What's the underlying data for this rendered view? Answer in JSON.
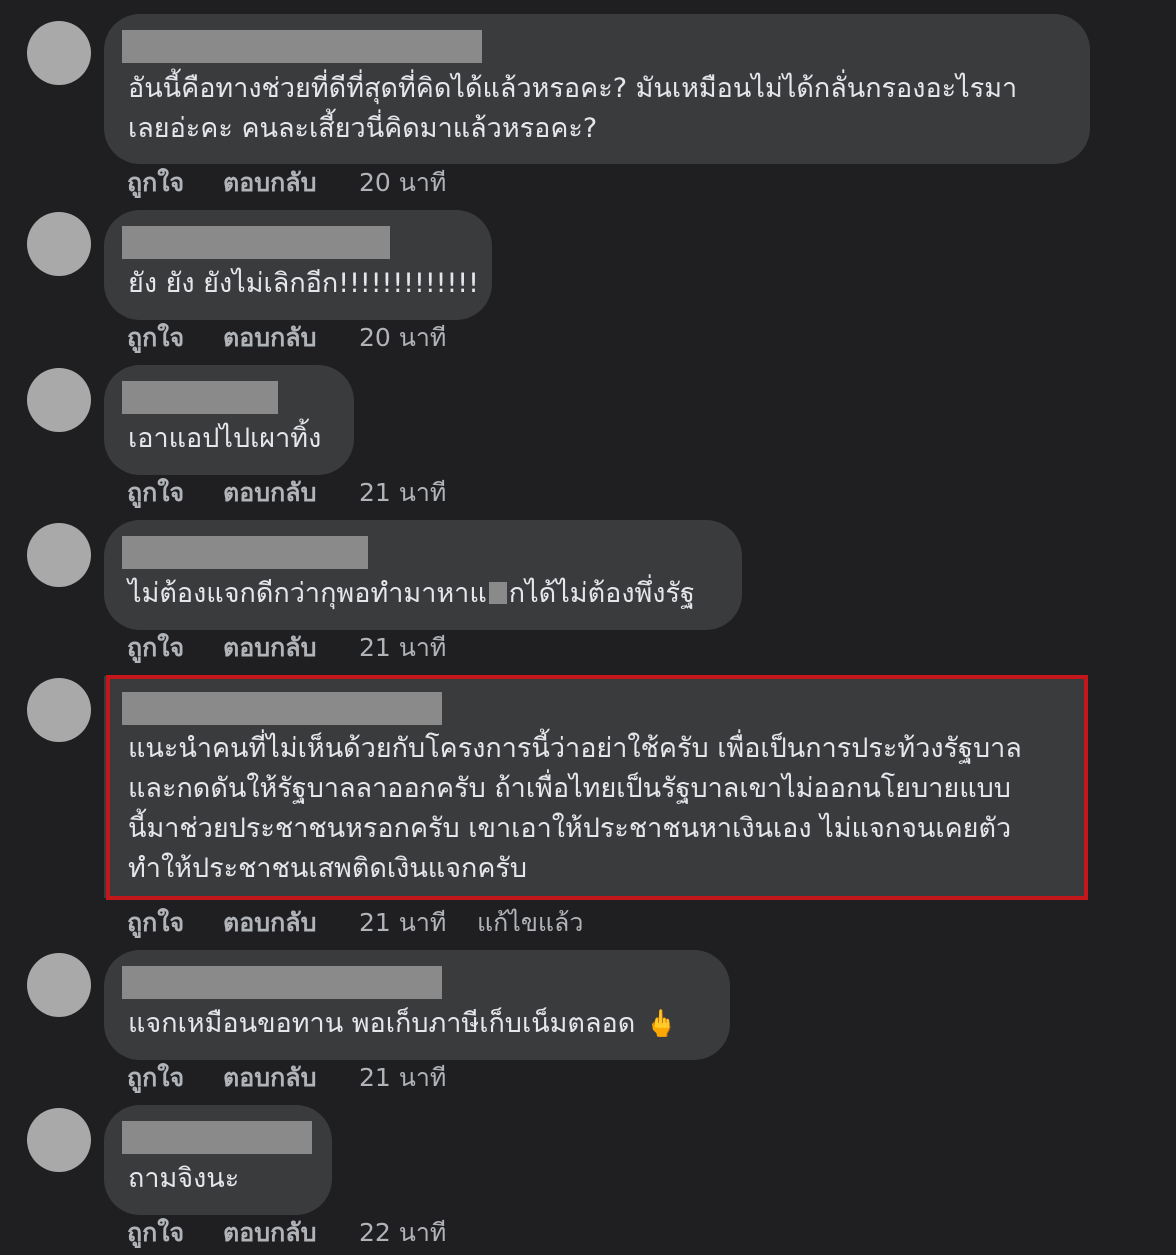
{
  "actions": {
    "like": "ถูกใจ",
    "reply": "ตอบกลับ",
    "edited": "แก้ไขแล้ว"
  },
  "comments": [
    {
      "lines": [
        "อันนี้คือทางช่วยที่ดีที่สุดที่คิดได้แล้วหรอคะ? มันเหมือนไม่ได้กลั่นกรองอะไรมา",
        "เลยอ่ะคะ คนละเสี้ยวนี่คิดมาแล้วหรอคะ?"
      ],
      "time": "20 นาที"
    },
    {
      "lines": [
        "ยัง ยัง ยังไม่เลิกอีก!!!!!!!!!!!!!"
      ],
      "time": "20 นาที"
    },
    {
      "lines": [
        "เอาแอปไปเผาทิ้ง"
      ],
      "time": "21 นาที"
    },
    {
      "line_before_redaction": "ไม่ต้องแจกดีกว่ากุพอทำมาหาแ",
      "line_after_redaction": "กได้ไม่ต้องพึ่งรัฐ",
      "time": "21 นาที"
    },
    {
      "lines": [
        "แนะนำคนที่ไม่เห็นด้วยกับโครงการนี้ว่าอย่าใช้ครับ เพื่อเป็นการประท้วงรัฐบาล",
        "และกดดันให้รัฐบาลลาออกครับ ถ้าเพื่อไทยเป็นรัฐบาลเขาไม่ออกนโยบายแบบ",
        "นี้มาช่วยประชาชนหรอกครับ เขาเอาให้ประชาชนหาเงินเอง ไม่แจกจนเคยตัว",
        "ทำให้ประชาชนเสพติดเงินแจกครับ"
      ],
      "time": "21 นาที",
      "edited": true,
      "highlighted": true,
      "highlight_color": "#c4171b"
    },
    {
      "lines": [
        "แจกเหมือนขอทาน พอเก็บภาษีเก็บเน็มตลอด"
      ],
      "emoji": "🖕",
      "time": "21 นาที"
    },
    {
      "lines": [
        "ถามจิงนะ"
      ],
      "time": "22 นาที"
    }
  ],
  "colors": {
    "background": "#1f1f21",
    "bubble": "#3a3b3c",
    "text": "#e4e6eb",
    "meta_text": "#b0b3b8",
    "redaction": "#8a8a8a",
    "avatar": "#a9a9a9"
  }
}
